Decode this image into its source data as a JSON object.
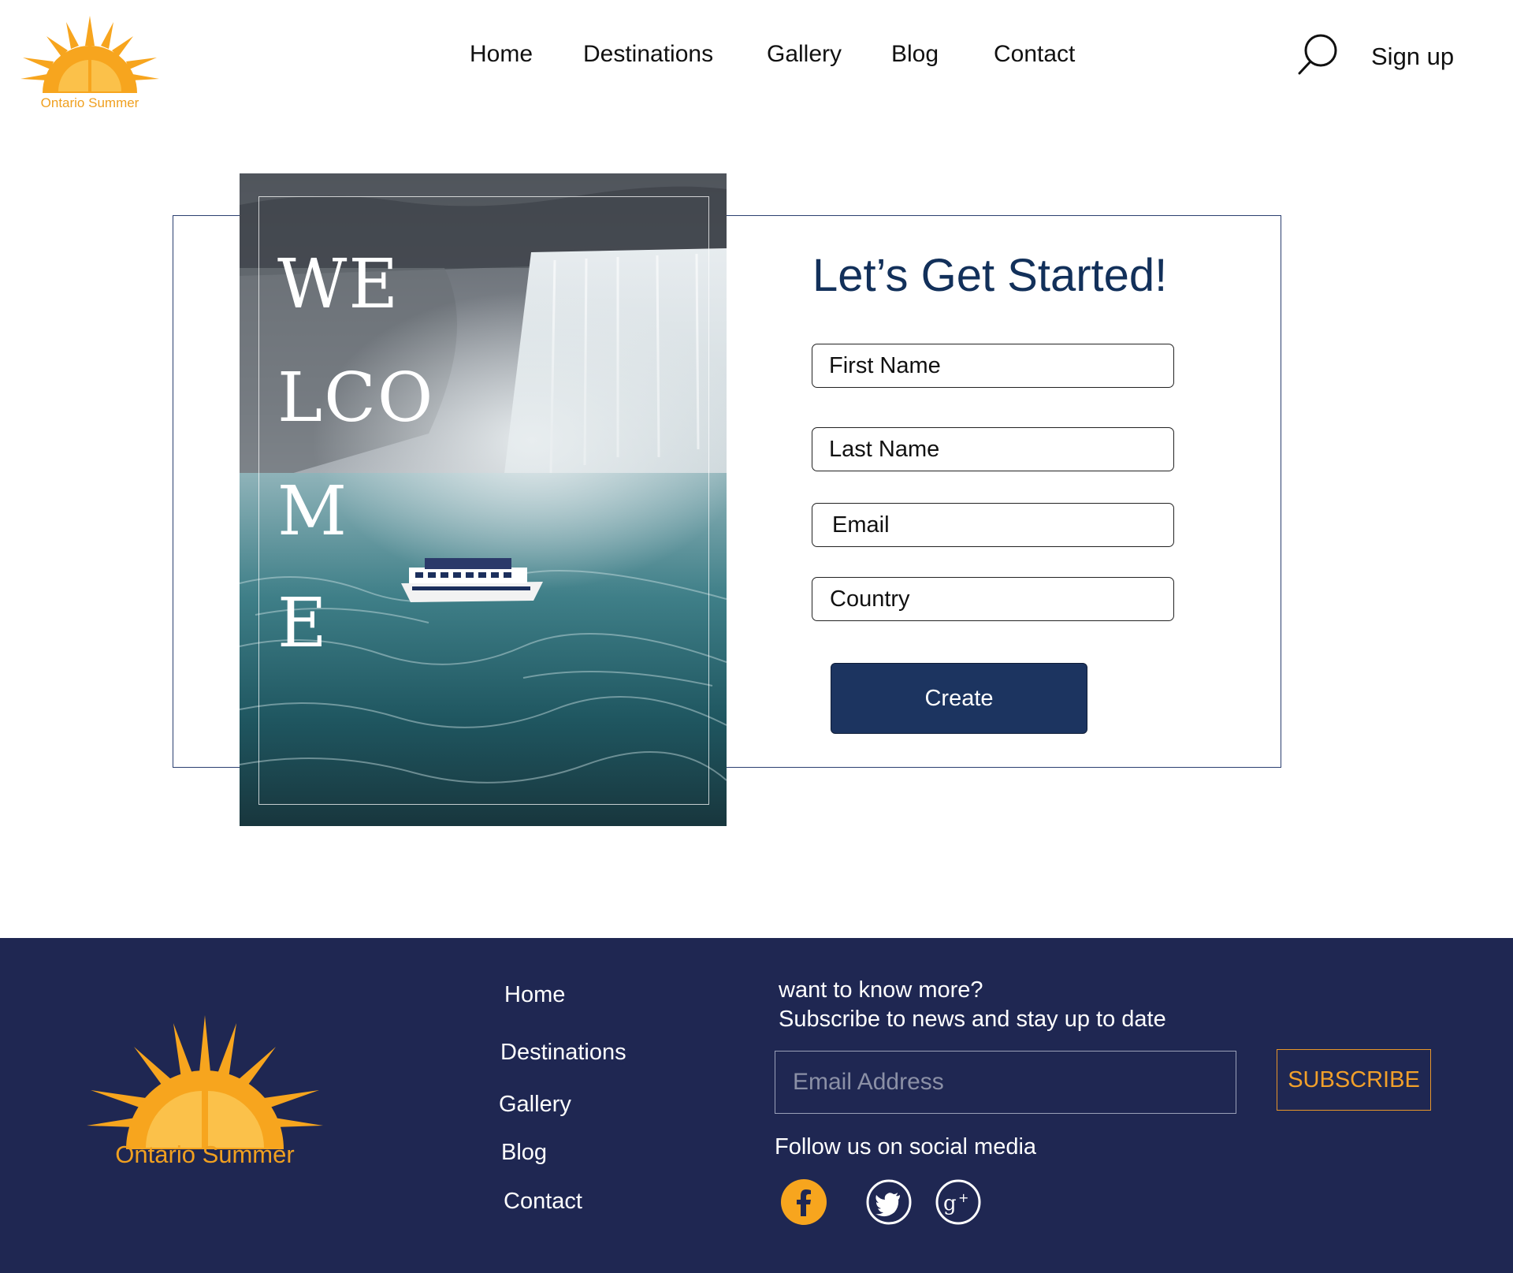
{
  "brand": {
    "name": "Ontario Summer",
    "accent": "#f7a51e",
    "navy": "#1f2752",
    "button": "#1c3460"
  },
  "header": {
    "nav": [
      "Home",
      "Destinations",
      "Gallery",
      "Blog",
      "Contact"
    ],
    "search_icon": "search-icon",
    "signup_label": "Sign up"
  },
  "hero": {
    "welcome_lines": [
      "WE",
      "LCO",
      "M",
      "E"
    ]
  },
  "form": {
    "title": "Let’s Get Started!",
    "fields": [
      {
        "placeholder": "First Name"
      },
      {
        "placeholder": "Last Name"
      },
      {
        "placeholder": "Email"
      },
      {
        "placeholder": "Country"
      }
    ],
    "submit_label": "Create"
  },
  "footer": {
    "links": [
      "Home",
      "Destinations",
      "Gallery",
      "Blog",
      "Contact"
    ],
    "newsletter_line1": "want to know more?",
    "newsletter_line2": "Subscribe to news and stay up to date",
    "email_placeholder": "Email Address",
    "subscribe_label": "SUBSCRIBE",
    "follow_label": "Follow us on social media",
    "social": [
      "facebook-icon",
      "twitter-icon",
      "google-plus-icon"
    ]
  }
}
